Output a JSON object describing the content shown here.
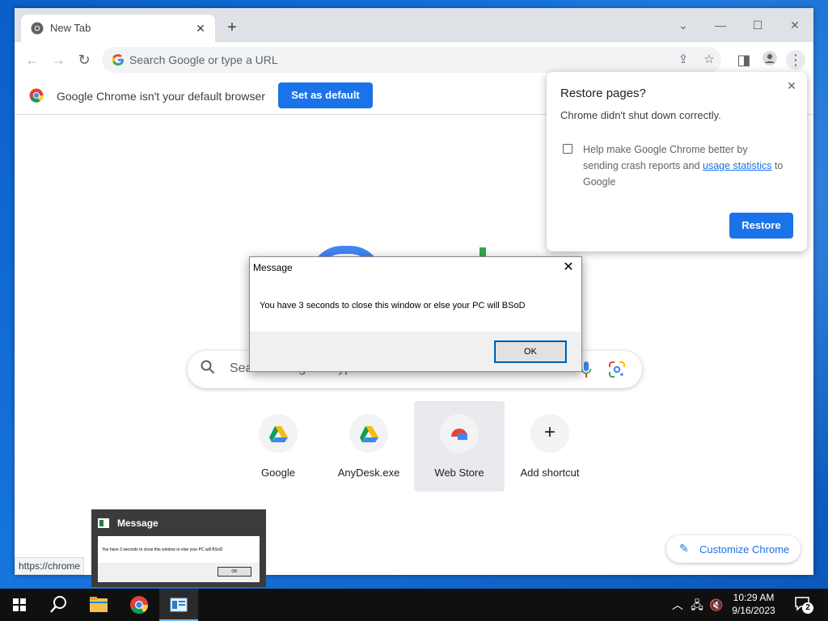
{
  "browser": {
    "tab": {
      "title": "New Tab"
    },
    "omnibox": {
      "placeholder": "Search Google or type a URL"
    },
    "infobar": {
      "message": "Google Chrome isn't your default browser",
      "button": "Set as default"
    },
    "ntp": {
      "search_placeholder": "Search Google or type a URL",
      "shortcuts": [
        {
          "label": "Google",
          "icon": "google-drive-icon"
        },
        {
          "label": "AnyDesk.exe",
          "icon": "google-drive-icon"
        },
        {
          "label": "Web Store",
          "icon": "web-store-icon"
        },
        {
          "label": "Add shortcut",
          "icon": "plus-icon"
        }
      ],
      "customize_label": "Customize Chrome"
    },
    "status_url": "https://chrome"
  },
  "restore_popup": {
    "title": "Restore pages?",
    "message": "Chrome didn't shut down correctly.",
    "help_prefix": "Help make Google Chrome better by sending crash reports and ",
    "help_link": "usage statistics",
    "help_suffix": " to Google",
    "button": "Restore"
  },
  "message_box": {
    "title": "Message",
    "text": "You have 3 seconds to close this window or else your PC will BSoD",
    "ok": "OK"
  },
  "thumbnail": {
    "title": "Message",
    "text": "You have 3 seconds to close this window or else your PC will BSoD",
    "ok": "OK"
  },
  "taskbar": {
    "time": "10:29 AM",
    "date": "9/16/2023",
    "notification_count": "2"
  },
  "colors": {
    "accent": "#1a73e8",
    "taskbar": "#101010",
    "desktop": "#1775de"
  }
}
